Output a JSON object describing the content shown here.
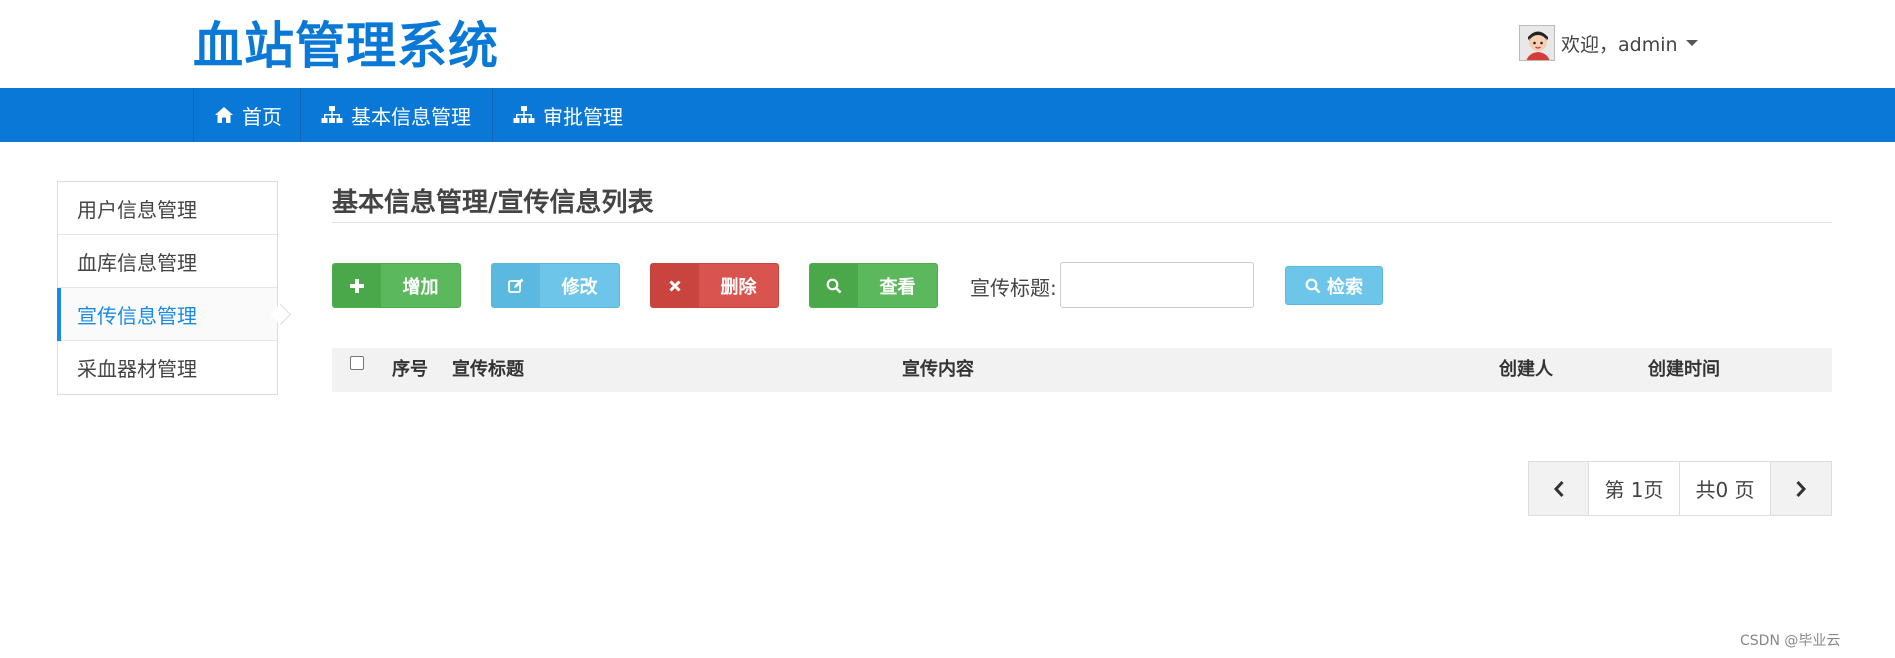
{
  "header": {
    "logo": "血站管理系统",
    "welcome": "欢迎，admin"
  },
  "nav": {
    "items": [
      {
        "label": "首页",
        "icon": "home-icon"
      },
      {
        "label": "基本信息管理",
        "icon": "sitemap-icon"
      },
      {
        "label": "审批管理",
        "icon": "sitemap-icon"
      }
    ]
  },
  "sidebar": {
    "items": [
      {
        "label": "用户信息管理"
      },
      {
        "label": "血库信息管理"
      },
      {
        "label": "宣传信息管理",
        "active": true
      },
      {
        "label": "采血器材管理"
      }
    ]
  },
  "main": {
    "title": "基本信息管理/宣传信息列表",
    "buttons": {
      "add": "增加",
      "edit": "修改",
      "delete": "删除",
      "view": "查看"
    },
    "search": {
      "label": "宣传标题:",
      "value": "",
      "button": "检索"
    },
    "table": {
      "columns": [
        "序号",
        "宣传标题",
        "宣传内容",
        "创建人",
        "创建时间"
      ],
      "rows": []
    },
    "pager": {
      "current": "第 1页",
      "total": "共0 页"
    }
  },
  "footer": {
    "watermark": "CSDN @毕业云"
  },
  "colors": {
    "brand": "#0a78d6",
    "active": "#1a8ae5",
    "green": "#5cb85c",
    "blue": "#6dc5e9",
    "red": "#d9534f"
  }
}
